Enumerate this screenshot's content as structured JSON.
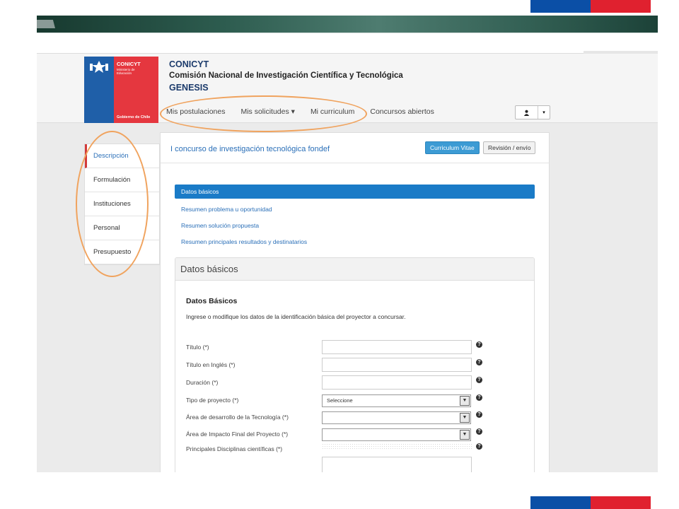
{
  "org": {
    "logo_brand": "CONICYT",
    "logo_sub": "Ministerio de Educación",
    "logo_gov": "Gobierno de Chile",
    "name": "CONICYT",
    "full_name": "Comisión Nacional de Investigación Científica y Tecnológica",
    "system": "GENESIS"
  },
  "nav": {
    "items": [
      "Mis postulaciones",
      "Mis solicitudes ▾",
      "Mi curriculum",
      "Concursos abiertos"
    ]
  },
  "user_menu": {
    "icon": "user-icon",
    "caret": "▾"
  },
  "sidebar": {
    "items": [
      "Descripción",
      "Formulación",
      "Instituciones",
      "Personal",
      "Presupuesto"
    ],
    "active": "Descripción"
  },
  "contest": {
    "title": "I concurso de investigación tecnológica fondef",
    "cv_button": "Curriculum Vitae",
    "review_button": "Revisión / envío"
  },
  "subnav": {
    "items": [
      "Datos básicos",
      "Resumen problema u oportunidad",
      "Resumen solución propuesta",
      "Resumen principales resultados y destinatarios"
    ],
    "active": "Datos básicos"
  },
  "panel": {
    "title": "Datos básicos",
    "heading": "Datos Básicos",
    "description": "Ingrese o modifique los datos de la identificación básica del proyector a concursar."
  },
  "form": {
    "fields": [
      {
        "label": "Título (*)",
        "kind": "text",
        "value": ""
      },
      {
        "label": "Título en Inglés (*)",
        "kind": "text",
        "value": ""
      },
      {
        "label": "Duración (*)",
        "kind": "text",
        "value": ""
      },
      {
        "label": "Tipo de proyecto (*)",
        "kind": "select",
        "value": "Seleccione"
      },
      {
        "label": "Área de desarrollo de la Tecnología (*)",
        "kind": "select",
        "value": ""
      },
      {
        "label": "Área de Impacto Final del Proyecto (*)",
        "kind": "select",
        "value": ""
      },
      {
        "label": "Principales Disciplinas científicas (*)",
        "kind": "textarea",
        "value": ""
      }
    ],
    "help_symbol": "?"
  },
  "colors": {
    "flag_blue": "#0b4fa6",
    "flag_red": "#e0212f",
    "accent": "#1a7bc7",
    "annotation": "#f0a35e"
  }
}
